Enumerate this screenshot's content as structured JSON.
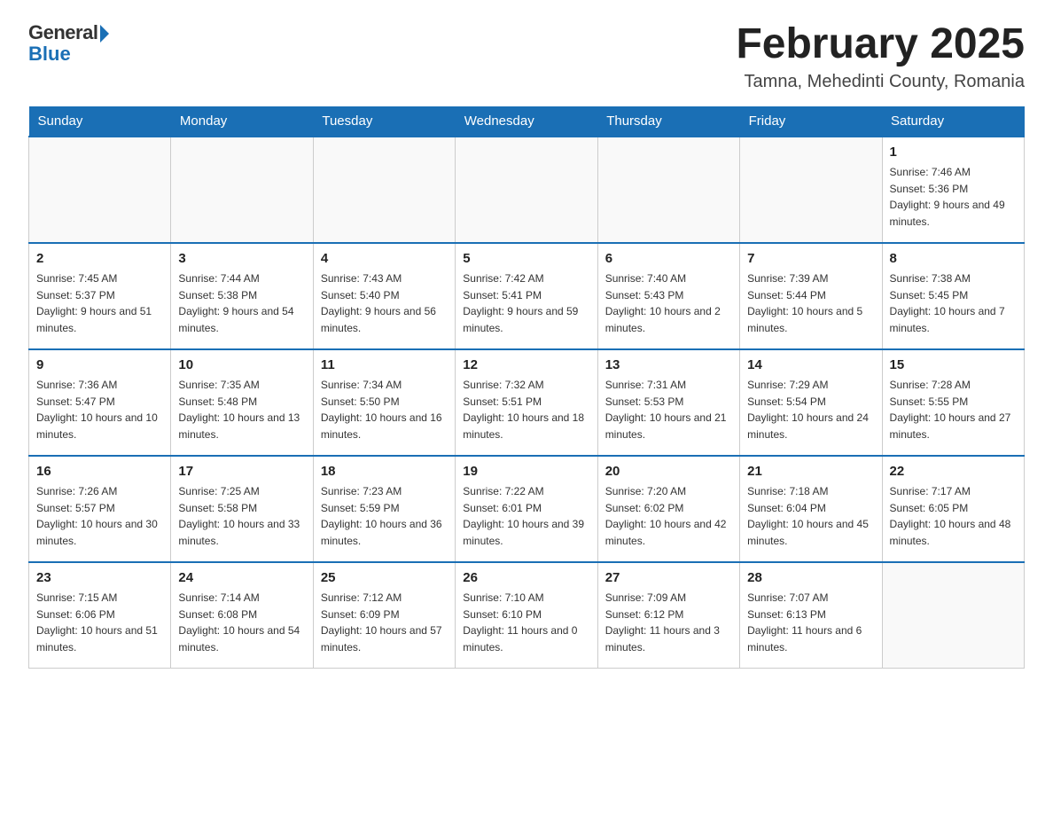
{
  "logo": {
    "general": "General",
    "blue": "Blue"
  },
  "header": {
    "title": "February 2025",
    "location": "Tamna, Mehedinti County, Romania"
  },
  "days_of_week": [
    "Sunday",
    "Monday",
    "Tuesday",
    "Wednesday",
    "Thursday",
    "Friday",
    "Saturday"
  ],
  "weeks": [
    [
      {
        "day": "",
        "info": ""
      },
      {
        "day": "",
        "info": ""
      },
      {
        "day": "",
        "info": ""
      },
      {
        "day": "",
        "info": ""
      },
      {
        "day": "",
        "info": ""
      },
      {
        "day": "",
        "info": ""
      },
      {
        "day": "1",
        "info": "Sunrise: 7:46 AM\nSunset: 5:36 PM\nDaylight: 9 hours and 49 minutes."
      }
    ],
    [
      {
        "day": "2",
        "info": "Sunrise: 7:45 AM\nSunset: 5:37 PM\nDaylight: 9 hours and 51 minutes."
      },
      {
        "day": "3",
        "info": "Sunrise: 7:44 AM\nSunset: 5:38 PM\nDaylight: 9 hours and 54 minutes."
      },
      {
        "day": "4",
        "info": "Sunrise: 7:43 AM\nSunset: 5:40 PM\nDaylight: 9 hours and 56 minutes."
      },
      {
        "day": "5",
        "info": "Sunrise: 7:42 AM\nSunset: 5:41 PM\nDaylight: 9 hours and 59 minutes."
      },
      {
        "day": "6",
        "info": "Sunrise: 7:40 AM\nSunset: 5:43 PM\nDaylight: 10 hours and 2 minutes."
      },
      {
        "day": "7",
        "info": "Sunrise: 7:39 AM\nSunset: 5:44 PM\nDaylight: 10 hours and 5 minutes."
      },
      {
        "day": "8",
        "info": "Sunrise: 7:38 AM\nSunset: 5:45 PM\nDaylight: 10 hours and 7 minutes."
      }
    ],
    [
      {
        "day": "9",
        "info": "Sunrise: 7:36 AM\nSunset: 5:47 PM\nDaylight: 10 hours and 10 minutes."
      },
      {
        "day": "10",
        "info": "Sunrise: 7:35 AM\nSunset: 5:48 PM\nDaylight: 10 hours and 13 minutes."
      },
      {
        "day": "11",
        "info": "Sunrise: 7:34 AM\nSunset: 5:50 PM\nDaylight: 10 hours and 16 minutes."
      },
      {
        "day": "12",
        "info": "Sunrise: 7:32 AM\nSunset: 5:51 PM\nDaylight: 10 hours and 18 minutes."
      },
      {
        "day": "13",
        "info": "Sunrise: 7:31 AM\nSunset: 5:53 PM\nDaylight: 10 hours and 21 minutes."
      },
      {
        "day": "14",
        "info": "Sunrise: 7:29 AM\nSunset: 5:54 PM\nDaylight: 10 hours and 24 minutes."
      },
      {
        "day": "15",
        "info": "Sunrise: 7:28 AM\nSunset: 5:55 PM\nDaylight: 10 hours and 27 minutes."
      }
    ],
    [
      {
        "day": "16",
        "info": "Sunrise: 7:26 AM\nSunset: 5:57 PM\nDaylight: 10 hours and 30 minutes."
      },
      {
        "day": "17",
        "info": "Sunrise: 7:25 AM\nSunset: 5:58 PM\nDaylight: 10 hours and 33 minutes."
      },
      {
        "day": "18",
        "info": "Sunrise: 7:23 AM\nSunset: 5:59 PM\nDaylight: 10 hours and 36 minutes."
      },
      {
        "day": "19",
        "info": "Sunrise: 7:22 AM\nSunset: 6:01 PM\nDaylight: 10 hours and 39 minutes."
      },
      {
        "day": "20",
        "info": "Sunrise: 7:20 AM\nSunset: 6:02 PM\nDaylight: 10 hours and 42 minutes."
      },
      {
        "day": "21",
        "info": "Sunrise: 7:18 AM\nSunset: 6:04 PM\nDaylight: 10 hours and 45 minutes."
      },
      {
        "day": "22",
        "info": "Sunrise: 7:17 AM\nSunset: 6:05 PM\nDaylight: 10 hours and 48 minutes."
      }
    ],
    [
      {
        "day": "23",
        "info": "Sunrise: 7:15 AM\nSunset: 6:06 PM\nDaylight: 10 hours and 51 minutes."
      },
      {
        "day": "24",
        "info": "Sunrise: 7:14 AM\nSunset: 6:08 PM\nDaylight: 10 hours and 54 minutes."
      },
      {
        "day": "25",
        "info": "Sunrise: 7:12 AM\nSunset: 6:09 PM\nDaylight: 10 hours and 57 minutes."
      },
      {
        "day": "26",
        "info": "Sunrise: 7:10 AM\nSunset: 6:10 PM\nDaylight: 11 hours and 0 minutes."
      },
      {
        "day": "27",
        "info": "Sunrise: 7:09 AM\nSunset: 6:12 PM\nDaylight: 11 hours and 3 minutes."
      },
      {
        "day": "28",
        "info": "Sunrise: 7:07 AM\nSunset: 6:13 PM\nDaylight: 11 hours and 6 minutes."
      },
      {
        "day": "",
        "info": ""
      }
    ]
  ]
}
